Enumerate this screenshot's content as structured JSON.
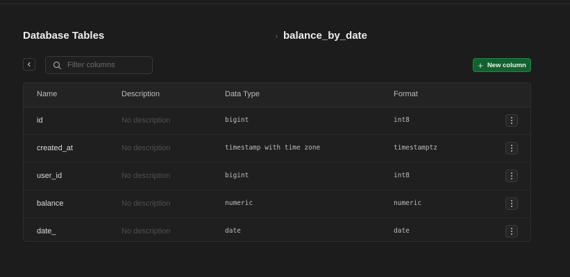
{
  "header": {
    "title": "Database Tables",
    "breadcrumb_separator": "›",
    "table_name": "balance_by_date"
  },
  "toolbar": {
    "back_icon": "chevron-left-icon",
    "search": {
      "icon": "search-icon",
      "placeholder": "Filter columns",
      "value": ""
    },
    "new_column": {
      "icon": "plus-icon",
      "label": "New column"
    }
  },
  "table": {
    "columns": [
      "Name",
      "Description",
      "Data Type",
      "Format"
    ],
    "rows": [
      {
        "name": "id",
        "description": "No description",
        "data_type": "bigint",
        "format": "int8"
      },
      {
        "name": "created_at",
        "description": "No description",
        "data_type": "timestamp with time zone",
        "format": "timestamptz"
      },
      {
        "name": "user_id",
        "description": "No description",
        "data_type": "bigint",
        "format": "int8"
      },
      {
        "name": "balance",
        "description": "No description",
        "data_type": "numeric",
        "format": "numeric"
      },
      {
        "name": "date_",
        "description": "No description",
        "data_type": "date",
        "format": "date"
      }
    ],
    "row_action_icon": "more-vertical-icon"
  },
  "colors": {
    "background": "#1c1c1c",
    "accent": "#12612f",
    "border": "#2e2e2e"
  }
}
